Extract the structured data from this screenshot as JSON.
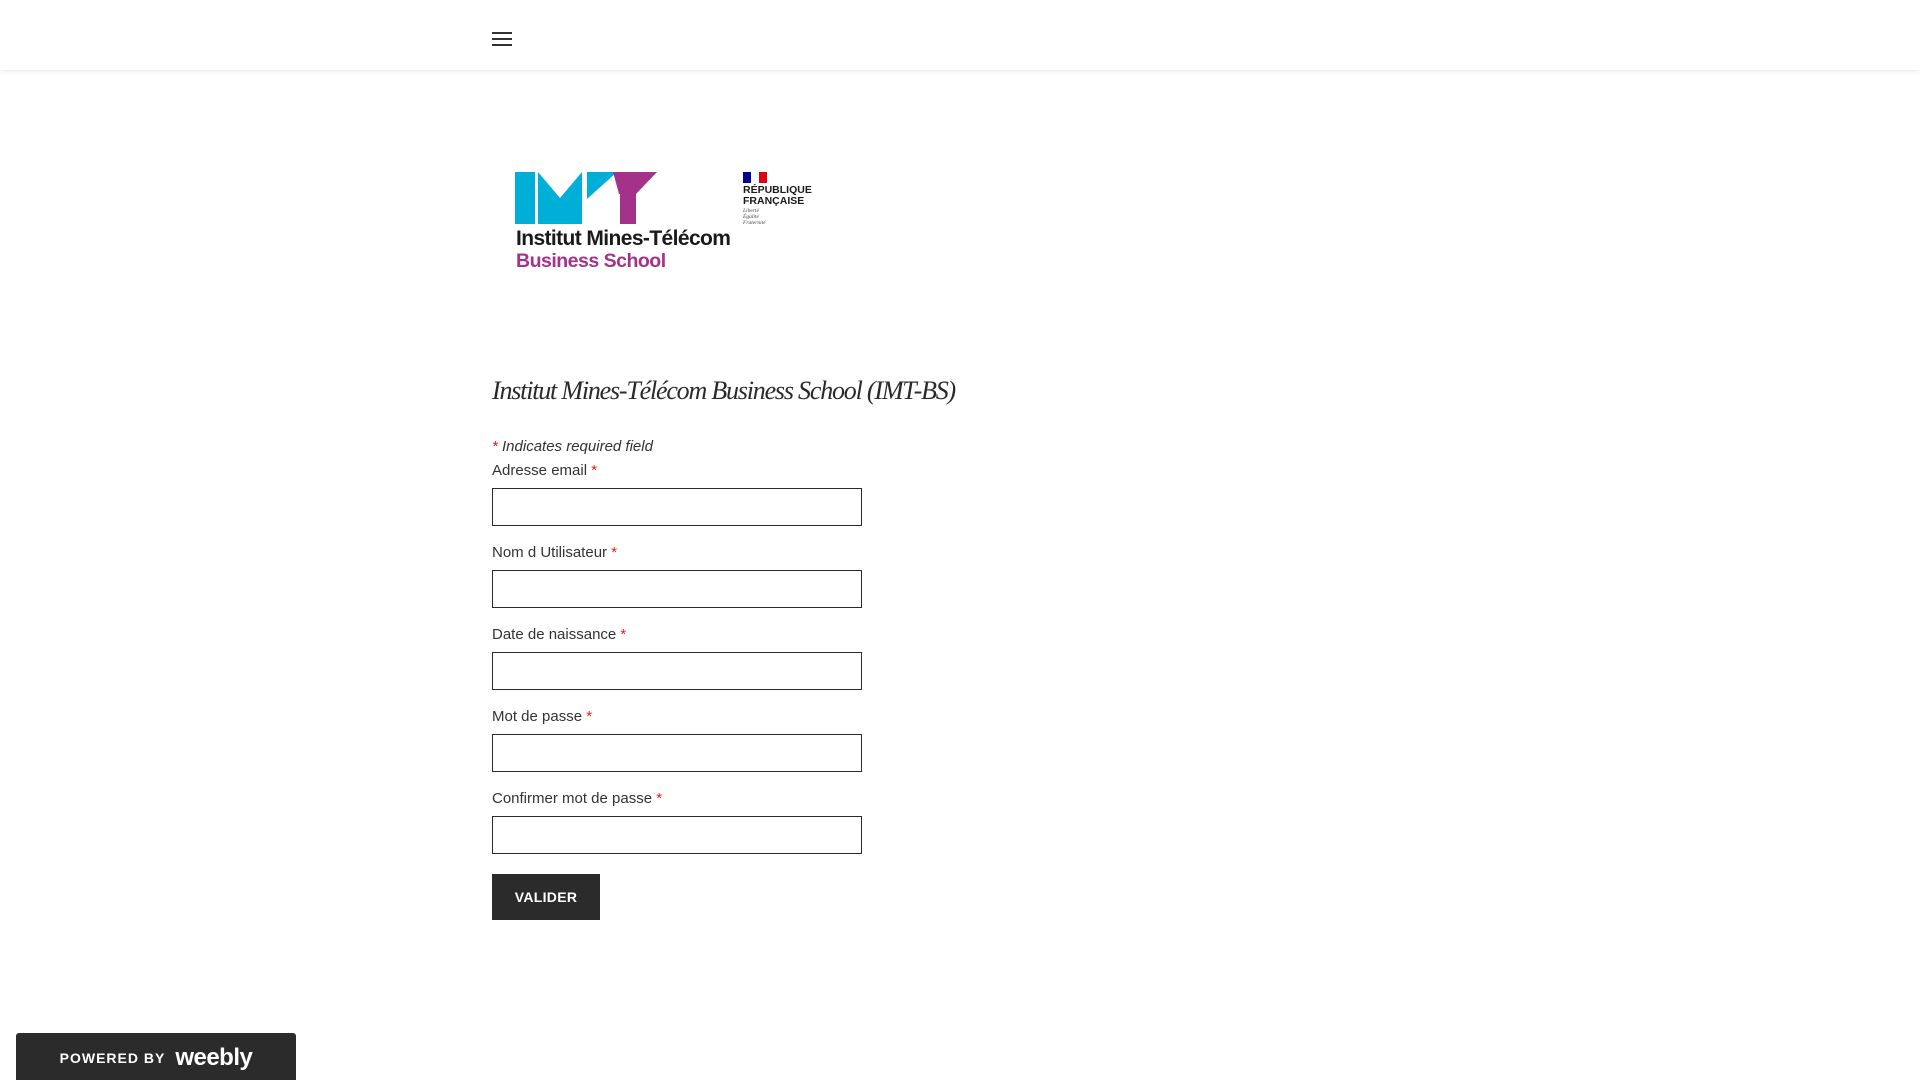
{
  "header": {
    "menu_icon": "hamburger-menu-icon"
  },
  "logo": {
    "line1": "Institut Mines-Télécom",
    "line2": "Business School",
    "colors": {
      "cyan": "#00afd8",
      "purple": "#a5328a"
    },
    "republique": {
      "line1": "RÉPUBLIQUE",
      "line2": "FRANÇAISE",
      "motto": [
        "Liberté",
        "Égalité",
        "Fraternité"
      ],
      "flag_colors": [
        "#000091",
        "#ffffff",
        "#e1000f"
      ]
    }
  },
  "page": {
    "title": "Institut Mines-Télécom Business School (IMT-BS)"
  },
  "form": {
    "required_star": "*",
    "required_note": "Indicates required field",
    "fields": [
      {
        "label": "Adresse email",
        "value": "",
        "placeholder": ""
      },
      {
        "label": "Nom d Utilisateur",
        "value": "",
        "placeholder": ""
      },
      {
        "label": "Date de naissance",
        "value": "",
        "placeholder": ""
      },
      {
        "label": "Mot de passe",
        "value": "",
        "placeholder": ""
      },
      {
        "label": "Confirmer mot de passe",
        "value": "",
        "placeholder": ""
      }
    ],
    "submit_label": "VALIDER"
  },
  "footer": {
    "powered_by": "POWERED BY",
    "brand": "weebly"
  },
  "colors": {
    "text": "#333333",
    "required": "#e01c1c",
    "button_bg": "#2b2b2b",
    "button_text": "#ffffff"
  }
}
